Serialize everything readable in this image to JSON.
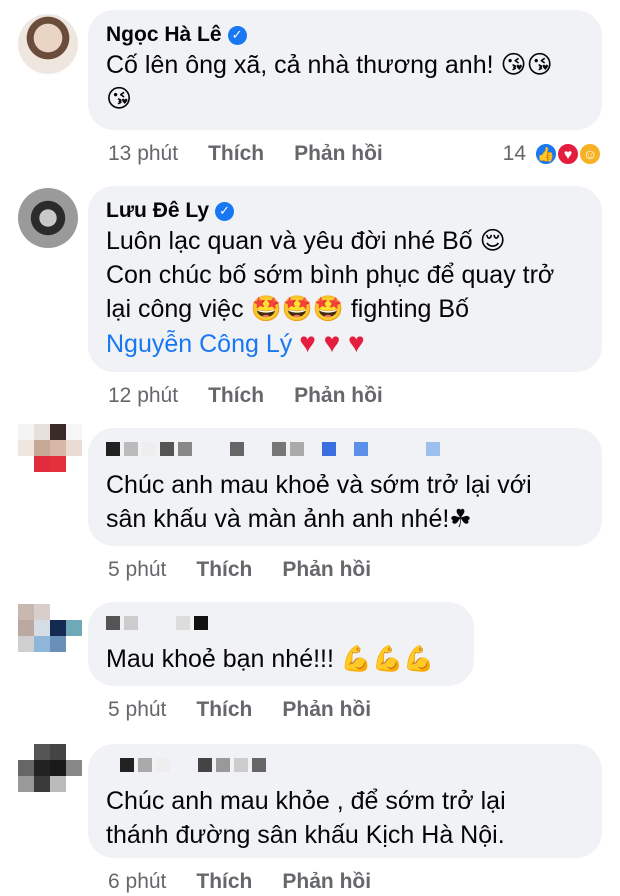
{
  "comments": [
    {
      "author": "Ngọc Hà Lê",
      "verified": true,
      "lines": [
        "Cố lên ông xã, cả nhà thương anh! 😘😘",
        "😘"
      ],
      "time": "13 phút",
      "like_label": "Thích",
      "reply_label": "Phản hồi",
      "reaction_count": "14"
    },
    {
      "author": "Lưu Đê Ly",
      "verified": true,
      "lines": [
        "Luôn lạc quan và yêu đời nhé Bố 😌",
        "Con chúc bố sớm bình phục để quay trở",
        "lại công việc 🤩🤩🤩 fighting Bố"
      ],
      "mention": "Nguyễn Công Lý",
      "hearts": "♥ ♥ ♥",
      "time": "12 phút",
      "like_label": "Thích",
      "reply_label": "Phản hồi"
    },
    {
      "lines": [
        "Chúc anh mau khoẻ và sớm trở lại với",
        "sân khấu và màn ảnh anh nhé!☘"
      ],
      "time": "5 phút",
      "like_label": "Thích",
      "reply_label": "Phản hồi"
    },
    {
      "lines": [
        "Mau khoẻ bạn nhé!!! 💪💪💪"
      ],
      "time": "5 phút",
      "like_label": "Thích",
      "reply_label": "Phản hồi"
    },
    {
      "lines": [
        "Chúc anh mau khỏe , để sớm trở lại",
        "thánh đường sân khấu Kịch Hà Nội."
      ],
      "time": "6 phút",
      "like_label": "Thích",
      "reply_label": "Phản hồi"
    }
  ],
  "icons": {
    "verified": "verified-badge-icon",
    "like": "like-reaction-icon",
    "love": "love-reaction-icon",
    "care": "care-reaction-icon"
  },
  "colors": {
    "bubble": "#f0f2f5",
    "meta": "#65676b",
    "link": "#1877f2",
    "verified": "#1877f2"
  }
}
